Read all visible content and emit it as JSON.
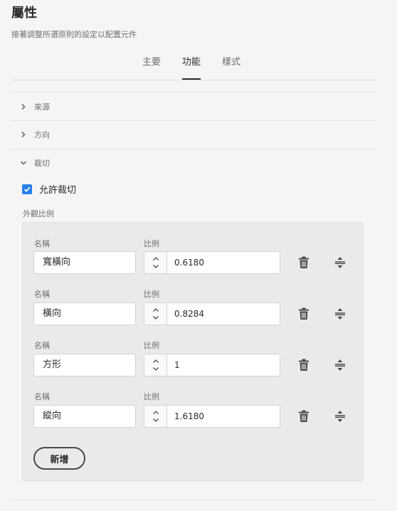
{
  "header": {
    "title": "屬性",
    "subtitle": "接著調整所選原則的設定以配置元件"
  },
  "tabs": [
    {
      "label": "主要",
      "active": false
    },
    {
      "label": "功能",
      "active": true
    },
    {
      "label": "樣式",
      "active": false
    }
  ],
  "accordion": {
    "source_label": "來源",
    "direction_label": "方向",
    "crop_label": "裁切"
  },
  "crop": {
    "allow_crop_label": "允許裁切",
    "allow_crop_checked": true,
    "aspect_ratio_label": "外觀比例"
  },
  "ratios": [
    {
      "name_label": "名稱",
      "name": "寬橫向",
      "ratio_label": "比例",
      "ratio": "0.6180"
    },
    {
      "name_label": "名稱",
      "name": "橫向",
      "ratio_label": "比例",
      "ratio": "0.8284"
    },
    {
      "name_label": "名稱",
      "name": "方形",
      "ratio_label": "比例",
      "ratio": "1"
    },
    {
      "name_label": "名稱",
      "name": "縱向",
      "ratio_label": "比例",
      "ratio": "1.6180"
    }
  ],
  "actions": {
    "add_label": "新增"
  },
  "icons": [
    "chevron-right-icon",
    "chevron-down-icon",
    "checkmark-icon",
    "stepper-up-icon",
    "stepper-down-icon",
    "trash-icon",
    "drag-handle-icon"
  ],
  "colors": {
    "accent": "#2680eb",
    "background": "#f5f5f5",
    "panel": "#eaeaea"
  }
}
